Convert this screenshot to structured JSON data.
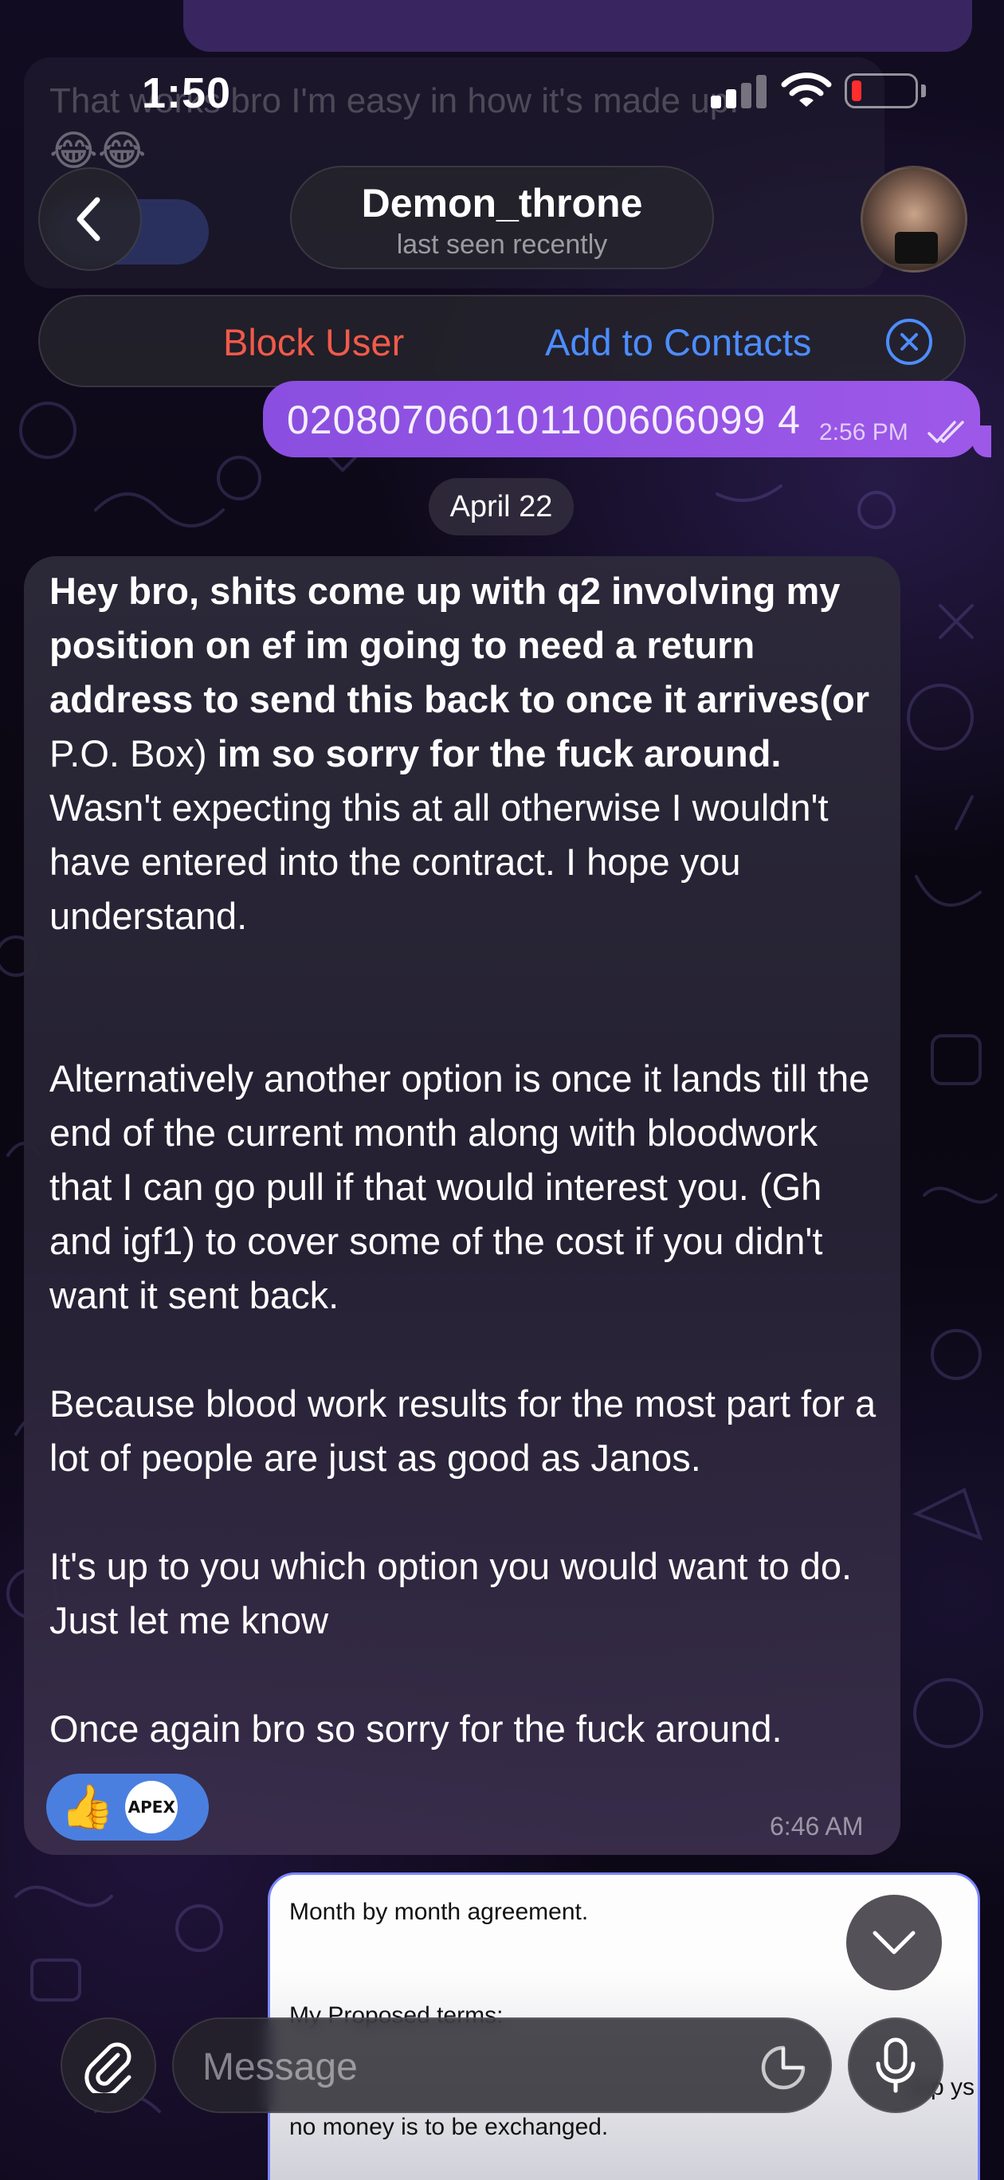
{
  "status_bar": {
    "time": "1:50"
  },
  "background_messages": {
    "top_text": "That works bro I'm easy in how it's made up.",
    "emoji": "😂😂"
  },
  "header": {
    "contact_name": "Demon_throne",
    "last_seen": "last seen recently"
  },
  "action_bar": {
    "block_label": "Block User",
    "add_label": "Add to Contacts"
  },
  "outgoing_message": {
    "text": "020807060101100606099 4",
    "time": "2:56 PM"
  },
  "date_separator": "April 22",
  "incoming_message": {
    "bold_1": "Hey bro, shits come up with q2 involving my position on ef im going to need a return address to send this back to once it arrives(or",
    "regular_1": " P.O. Box) ",
    "bold_2": "im so sorry for the fuck around.",
    "regular_2": " Wasn't expecting this at all otherwise I wouldn't have entered into the contract. I hope you understand.",
    "para_2": "Alternatively another option is once it lands till the end of the current month along with bloodwork that I can go pull if that would interest you. (Gh and igf1) to cover some of the cost if you didn't want it sent back.",
    "para_3": "Because blood work results for the most part for a lot of people are just as good as Janos.",
    "para_4": "It's up to you which option you would want to do. Just let me know",
    "para_5": "Once again bro so sorry for the fuck around.",
    "time": "6:46 AM",
    "reactions": {
      "emoji": "👍",
      "badge_text": "APEX"
    }
  },
  "document_preview": {
    "line_1": "Month by month agreement.",
    "line_2": "My Proposed terms:",
    "line_3": "no money is to be exchanged.",
    "line_4": "e p     ys"
  },
  "composer": {
    "placeholder": "Message"
  },
  "colors": {
    "accent_blue": "#4c8dff",
    "danger_red": "#f15a4a",
    "outgoing_purple": "#9d58e8",
    "reaction_blue": "#4a7fe0"
  },
  "icons": [
    "back-chevron-icon",
    "close-circle-icon",
    "double-check-icon",
    "paperclip-icon",
    "sticker-icon",
    "microphone-icon",
    "chevron-down-icon"
  ]
}
